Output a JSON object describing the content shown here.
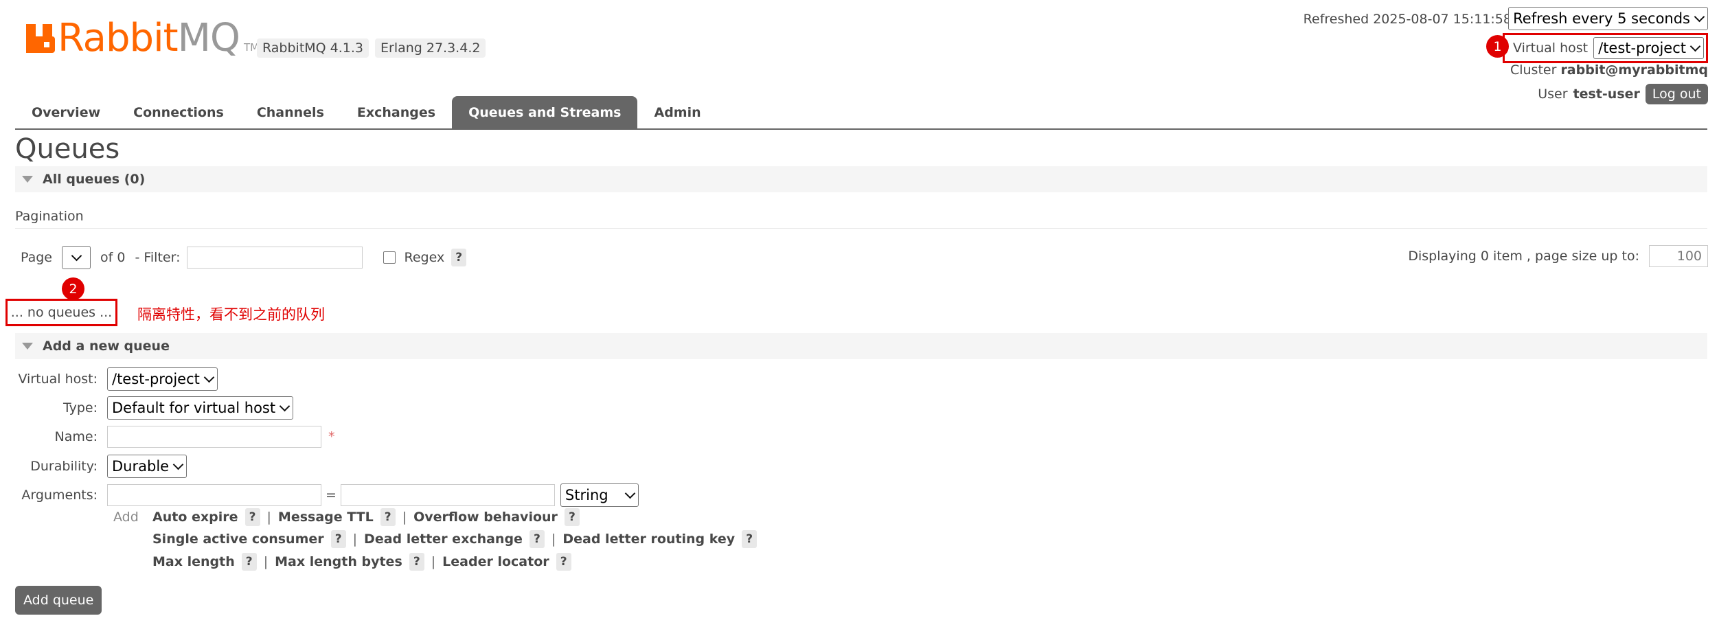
{
  "header": {
    "logo_part1": "Rabbit",
    "logo_part2": "MQ",
    "logo_tm": "TM",
    "version": "RabbitMQ 4.1.3",
    "erlang": "Erlang 27.3.4.2",
    "refreshed": "Refreshed 2025-08-07 15:11:58",
    "refresh_select": "Refresh every 5 seconds",
    "vhost_label": "Virtual host",
    "vhost_value": "/test-project",
    "cluster_label": "Cluster",
    "cluster_value": "rabbit@myrabbitmq",
    "user_label": "User",
    "user_value": "test-user",
    "logout_label": "Log out"
  },
  "annotations": {
    "marker1": "1",
    "marker2": "2",
    "note": "隔离特性，看不到之前的队列",
    "marker_color": "#e00000"
  },
  "tabs": [
    {
      "label": "Overview"
    },
    {
      "label": "Connections"
    },
    {
      "label": "Channels"
    },
    {
      "label": "Exchanges"
    },
    {
      "label": "Queues and Streams",
      "active": true
    },
    {
      "label": "Admin"
    }
  ],
  "page": {
    "title": "Queues",
    "all_queues_header": "All queues (0)",
    "pagination_label": "Pagination",
    "page_label": "Page",
    "of_label": "of 0",
    "filter_label": "- Filter:",
    "regex_label": "Regex",
    "help": "?",
    "displaying": "Displaying 0 item , page size up to:",
    "page_size": "100",
    "no_queues": "... no queues ..."
  },
  "add_queue": {
    "header": "Add a new queue",
    "vhost_label": "Virtual host:",
    "vhost_value": "/test-project",
    "type_label": "Type:",
    "type_value": "Default for virtual host",
    "name_label": "Name:",
    "required_mark": "*",
    "durability_label": "Durability:",
    "durability_value": "Durable",
    "arguments_label": "Arguments:",
    "equals": "=",
    "arg_type_value": "String",
    "add_label": "Add",
    "arg_links_row1": [
      "Auto expire",
      "Message TTL",
      "Overflow behaviour"
    ],
    "arg_links_row2": [
      "Single active consumer",
      "Dead letter exchange",
      "Dead letter routing key"
    ],
    "arg_links_row3": [
      "Max length",
      "Max length bytes",
      "Leader locator"
    ],
    "separator": "|",
    "submit_label": "Add queue"
  },
  "colors": {
    "brand_orange": "#ff6600",
    "tab_active_bg": "#666666",
    "annotation_red": "#e00000"
  }
}
